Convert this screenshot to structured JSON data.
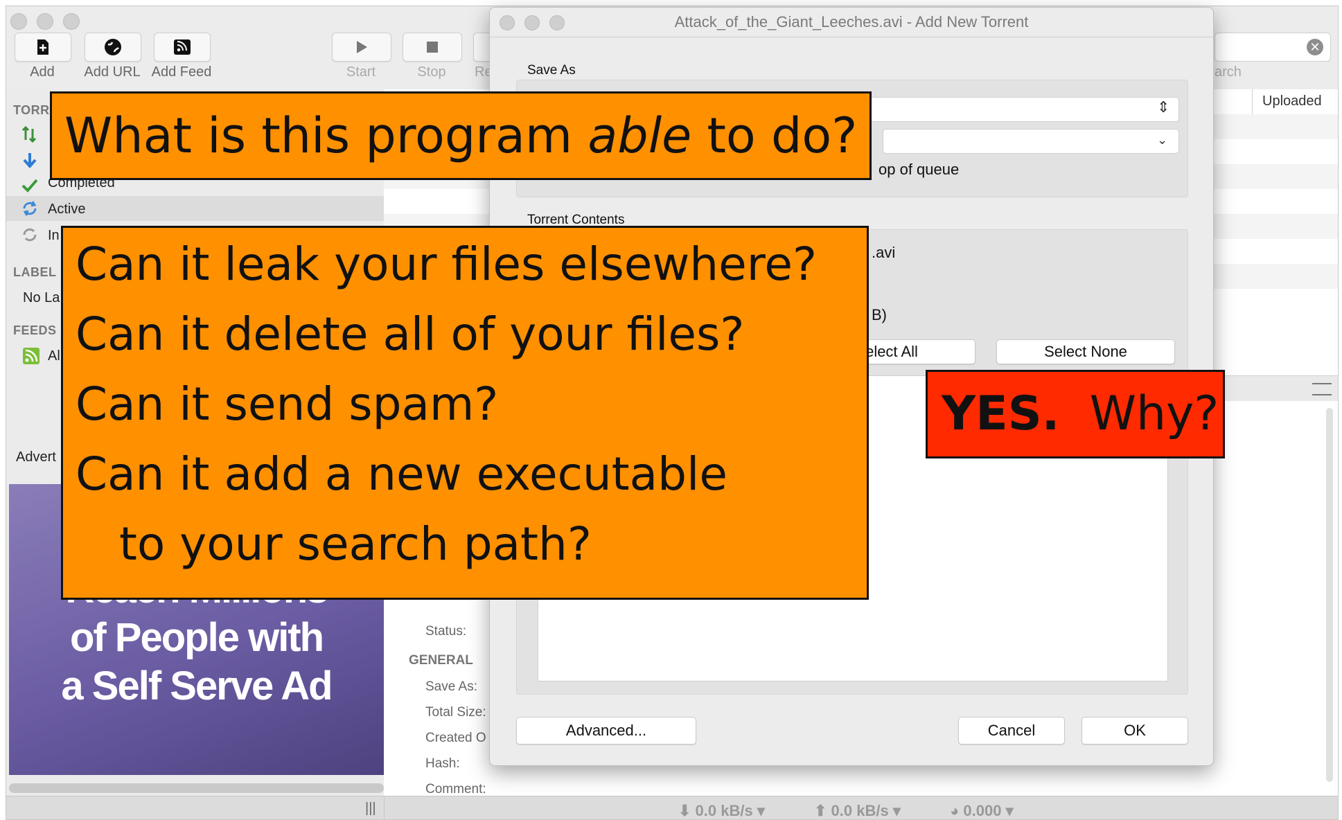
{
  "main": {
    "toolbar": {
      "add": "Add",
      "add_url": "Add URL",
      "add_feed": "Add Feed",
      "start": "Start",
      "stop": "Stop",
      "remove_partial": "Re",
      "search_partial": "arch"
    },
    "sidebar": {
      "torrents_head": "TORR",
      "completed": "Completed",
      "active": "Active",
      "inactive_partial": "In",
      "labels_head": "LABEL",
      "no_label_partial": "No La",
      "feeds_head": "FEEDS",
      "feeds_all_partial": "Al",
      "advert_partial": "Advert"
    },
    "ad": {
      "line1": "Reach Millions",
      "line2": "of People with",
      "line3": "a Self Serve Ad"
    },
    "column_uploaded": "Uploaded",
    "details": {
      "status": "Status:",
      "general_head": "GENERAL",
      "save_as": "Save As:",
      "total_size": "Total Size:",
      "created_on_partial": "Created O",
      "hash": "Hash:",
      "comment": "Comment:"
    },
    "statusbar": {
      "down": "⬇ 0.0 kB/s ▾",
      "up": "⬆ 0.0 kB/s ▾",
      "ratio": "◕ 0.000 ▾",
      "grip": "|||"
    }
  },
  "dialog": {
    "title": "Attack_of_the_Giant_Leeches.avi - Add New Torrent",
    "save_as_label": "Save As",
    "queue_partial": "op of queue",
    "contents_label": "Torrent Contents",
    "file_partial": ".avi",
    "size_partial": "B)",
    "select_all_partial": "elect All",
    "select_none": "Select None",
    "advanced": "Advanced...",
    "cancel": "Cancel",
    "ok": "OK"
  },
  "overlays": {
    "title_q_before": "What is this program ",
    "title_q_em": "able",
    "title_q_after": " to do?",
    "questions": [
      "Can it leak your files elsewhere?",
      "Can it delete all of your files?",
      "Can it send spam?",
      "Can it add a new executable",
      "   to your search path?"
    ],
    "answer_yes": "YES.",
    "answer_why": "  Why?"
  }
}
